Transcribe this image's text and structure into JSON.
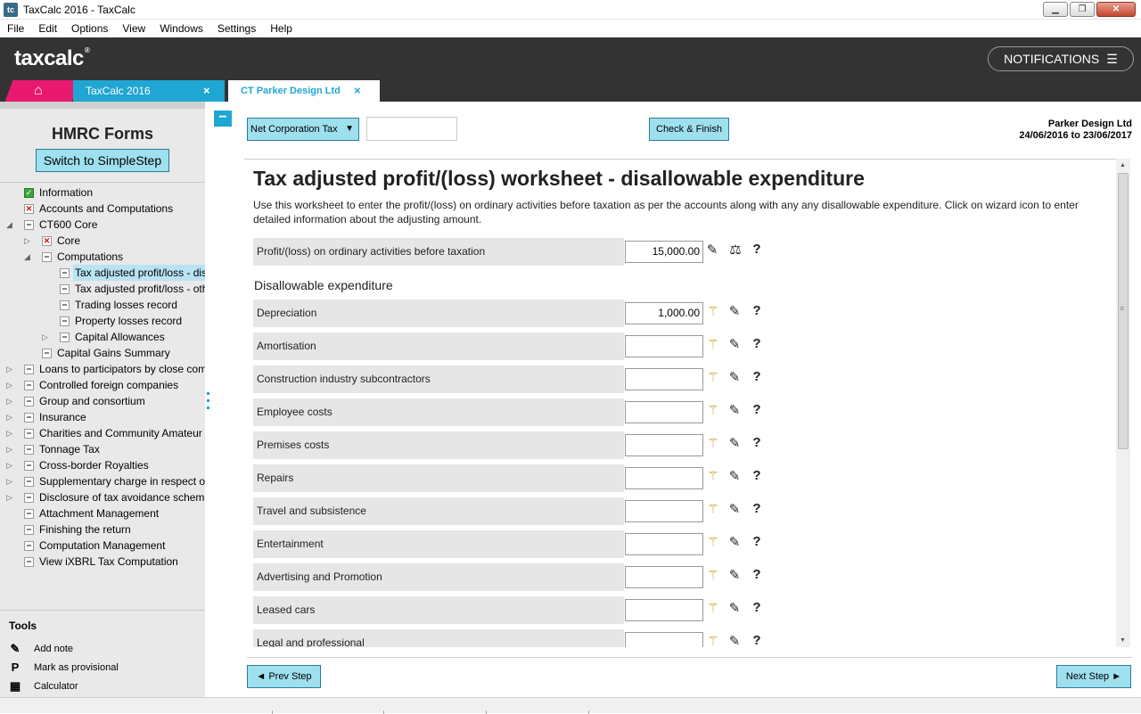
{
  "window": {
    "title": "TaxCalc 2016 - TaxCalc",
    "app_icon_text": "tc"
  },
  "menu": [
    "File",
    "Edit",
    "Options",
    "View",
    "Windows",
    "Settings",
    "Help"
  ],
  "header": {
    "logo": "taxcalc",
    "logo_mark": "®",
    "notifications_label": "NOTIFICATIONS",
    "notifications_icon": "☰"
  },
  "tabs": {
    "home_icon": "⌂",
    "tab1_label": "TaxCalc 2016",
    "tab2_label": "CT Parker Design Ltd",
    "close_glyph": "×"
  },
  "sidebar": {
    "title": "HMRC Forms",
    "switch_button": "Switch to SimpleStep",
    "tree": [
      {
        "label": "Information",
        "icon": "ok",
        "level": 0,
        "expander": ""
      },
      {
        "label": "Accounts and Computations",
        "icon": "err",
        "level": 0,
        "expander": ""
      },
      {
        "label": "CT600 Core",
        "icon": "doc",
        "level": 0,
        "expander": "◢"
      },
      {
        "label": "Core",
        "icon": "err",
        "level": 1,
        "expander": "▷"
      },
      {
        "label": "Computations",
        "icon": "doc",
        "level": 1,
        "expander": "◢"
      },
      {
        "label": "Tax adjusted profit/loss - disallowable expenditure",
        "icon": "doc",
        "level": 2,
        "expander": "",
        "selected": true
      },
      {
        "label": "Tax adjusted profit/loss - other",
        "icon": "doc",
        "level": 2,
        "expander": ""
      },
      {
        "label": "Trading losses record",
        "icon": "doc",
        "level": 2,
        "expander": ""
      },
      {
        "label": "Property losses record",
        "icon": "doc",
        "level": 2,
        "expander": ""
      },
      {
        "label": "Capital Allowances",
        "icon": "doc",
        "level": 2,
        "expander": "▷"
      },
      {
        "label": "Capital Gains Summary",
        "icon": "doc",
        "level": 1,
        "expander": ""
      },
      {
        "label": "Loans to participators by close companies",
        "icon": "doc",
        "level": 0,
        "expander": "▷"
      },
      {
        "label": "Controlled foreign companies",
        "icon": "doc",
        "level": 0,
        "expander": "▷"
      },
      {
        "label": "Group and consortium",
        "icon": "doc",
        "level": 0,
        "expander": "▷"
      },
      {
        "label": "Insurance",
        "icon": "doc",
        "level": 0,
        "expander": "▷"
      },
      {
        "label": "Charities and Community Amateur Sports Clubs",
        "icon": "doc",
        "level": 0,
        "expander": "▷"
      },
      {
        "label": "Tonnage Tax",
        "icon": "doc",
        "level": 0,
        "expander": "▷"
      },
      {
        "label": "Cross-border Royalties",
        "icon": "doc",
        "level": 0,
        "expander": "▷"
      },
      {
        "label": "Supplementary charge in respect of",
        "icon": "doc",
        "level": 0,
        "expander": "▷"
      },
      {
        "label": "Disclosure of tax avoidance schemes",
        "icon": "doc",
        "level": 0,
        "expander": "▷"
      },
      {
        "label": "Attachment Management",
        "icon": "doc",
        "level": 0,
        "expander": ""
      },
      {
        "label": "Finishing the return",
        "icon": "doc",
        "level": 0,
        "expander": ""
      },
      {
        "label": "Computation Management",
        "icon": "doc",
        "level": 0,
        "expander": ""
      },
      {
        "label": "View iXBRL Tax Computation",
        "icon": "doc",
        "level": 0,
        "expander": ""
      }
    ],
    "tools_title": "Tools",
    "tools": [
      {
        "label": "Add note",
        "icon": "✎"
      },
      {
        "label": "Mark as provisional",
        "icon": "P"
      },
      {
        "label": "Calculator",
        "icon": "▦"
      }
    ]
  },
  "toolbar": {
    "select_value": "Net Corporation Tax",
    "select_arrow": "▼",
    "collapse_glyph": "−",
    "check_button": "Check & Finish",
    "company_name": "Parker Design Ltd",
    "period": "24/06/2016 to 23/06/2017"
  },
  "worksheet": {
    "title": "Tax adjusted profit/(loss) worksheet - disallowable expenditure",
    "description": "Use this worksheet to enter the profit/(loss) on ordinary activities before taxation as per the accounts along with any any disallowable expenditure. Click on wizard icon to enter detailed information about the adjusting amount.",
    "profit_row": {
      "label": "Profit/(loss) on ordinary activities before taxation",
      "value": "15,000.00"
    },
    "section_title": "Disallowable expenditure",
    "rows": [
      {
        "label": "Depreciation",
        "value": "1,000.00"
      },
      {
        "label": "Amortisation",
        "value": ""
      },
      {
        "label": "Construction industry subcontractors",
        "value": ""
      },
      {
        "label": "Employee costs",
        "value": ""
      },
      {
        "label": "Premises costs",
        "value": ""
      },
      {
        "label": "Repairs",
        "value": ""
      },
      {
        "label": "Travel and subsistence",
        "value": ""
      },
      {
        "label": "Entertainment",
        "value": ""
      },
      {
        "label": "Advertising and Promotion",
        "value": ""
      },
      {
        "label": "Leased cars",
        "value": ""
      },
      {
        "label": "Legal and professional",
        "value": ""
      }
    ],
    "icons": {
      "wand": "⚚",
      "pencil": "✎",
      "help": "?",
      "scales": "⚖"
    }
  },
  "footer": {
    "prev_button": "◄ Prev Step",
    "next_button": "Next Step ►"
  },
  "colors": {
    "accent": "#1fa6d2",
    "button_bg": "#9fe0ef",
    "home_tab": "#e8196e",
    "header_bg": "#333333"
  }
}
